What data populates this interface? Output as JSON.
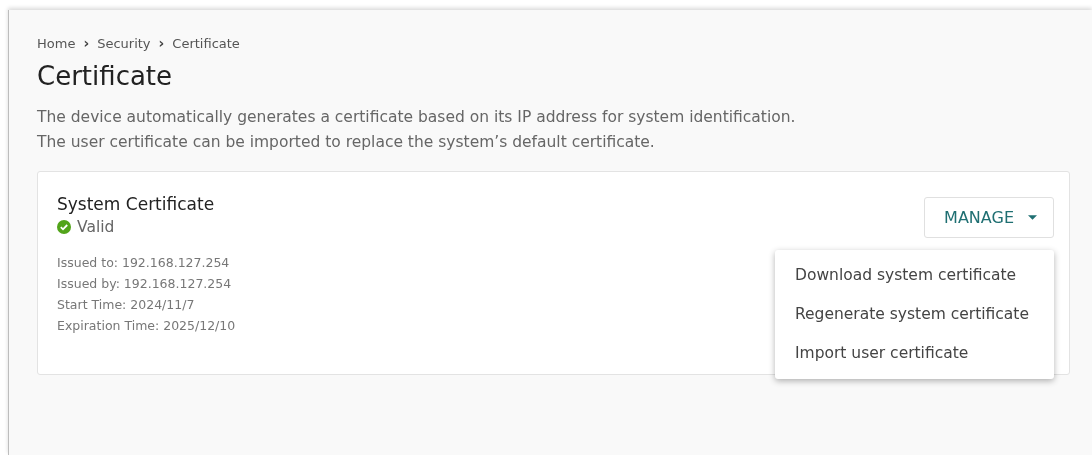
{
  "breadcrumb": [
    {
      "label": "Home",
      "separator": "›"
    },
    {
      "label": "Security",
      "separator": "›"
    },
    {
      "label": "Certificate"
    }
  ],
  "title": "Certificate",
  "description": [
    "The device automatically generates a certificate based on its IP address for system identification.",
    "The user certificate can be imported to replace the system’s default certificate."
  ],
  "card": {
    "title": "System Certificate",
    "status": {
      "kind": "valid",
      "label": "Valid"
    },
    "details": [
      "Issued to: 192.168.127.254",
      "Issued by: 192.168.127.254",
      "Start Time: 2024/11/7",
      "Expiration Time: 2025/12/10"
    ],
    "manage": {
      "label": "MANAGE",
      "expanded": true,
      "menu": [
        "Download system certificate",
        "Regenerate system certificate",
        "Import user certificate"
      ]
    }
  }
}
